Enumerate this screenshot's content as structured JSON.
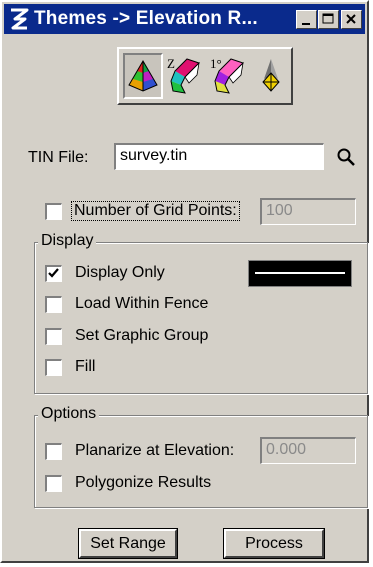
{
  "window": {
    "title": "Themes -> Elevation R..."
  },
  "toolbar": {
    "tools": [
      {
        "name": "elevation-range-tool",
        "selected": true
      },
      {
        "name": "height-range-tool",
        "glyph": "Z"
      },
      {
        "name": "slope-range-tool",
        "glyph": "1°"
      },
      {
        "name": "aspect-tool"
      }
    ]
  },
  "tin": {
    "label": "TIN File:",
    "value": "survey.tin"
  },
  "grid": {
    "label": "Number of Grid Points:",
    "value": "100",
    "checked": false
  },
  "display": {
    "legend": "Display",
    "options": [
      {
        "label": "Display Only",
        "checked": true
      },
      {
        "label": "Load Within Fence",
        "checked": false
      },
      {
        "label": "Set Graphic Group",
        "checked": false
      },
      {
        "label": "Fill",
        "checked": false
      }
    ],
    "swatch_color": "#000000"
  },
  "options": {
    "legend": "Options",
    "planarize_label": "Planarize at Elevation:",
    "planarize_value": "0.000",
    "polygonize_label": "Polygonize Results"
  },
  "buttons": {
    "set_range": "Set Range",
    "process": "Process"
  },
  "colors": {
    "titlebar": "#0a2a8c",
    "face": "#d4d0c8"
  }
}
